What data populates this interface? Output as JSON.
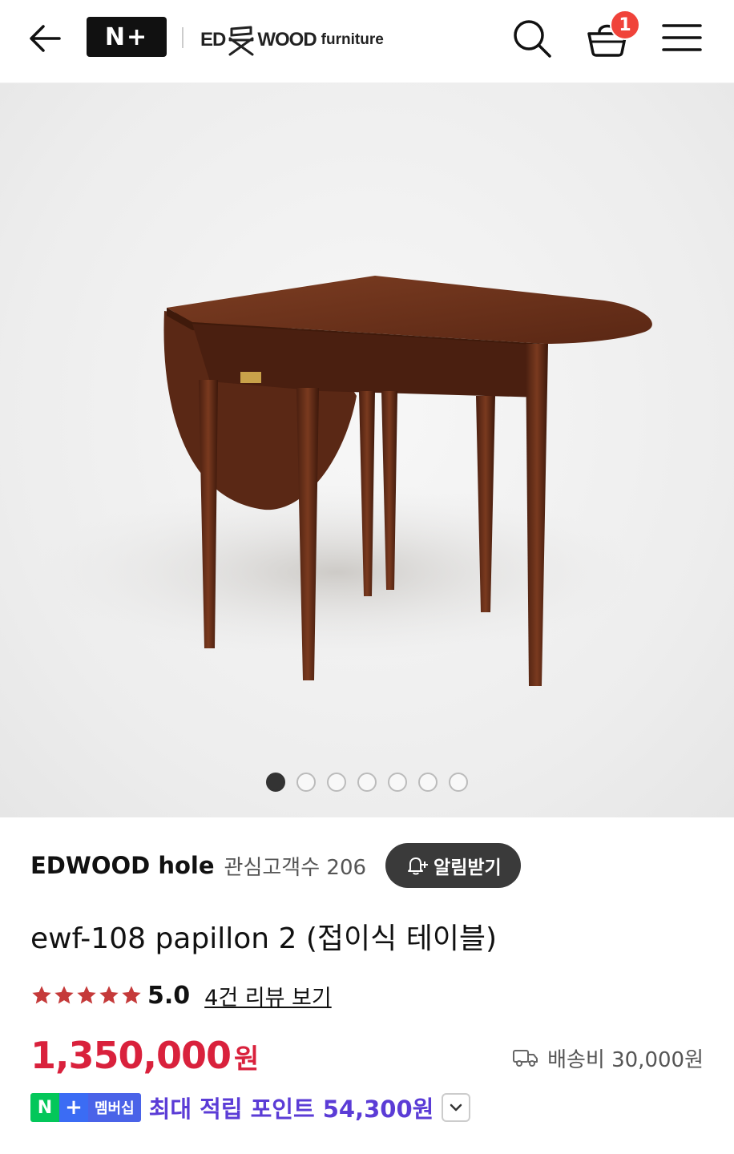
{
  "header": {
    "nplus_logo": "N+",
    "brand_left": "ED",
    "brand_right": "WOOD",
    "brand_suffix": "furniture",
    "cart_count": "1"
  },
  "gallery": {
    "total_images": 7,
    "active_index": 0
  },
  "store": {
    "name": "EDWOOD hole",
    "watchers_label": "관심고객수 206",
    "alert_button": "알림받기"
  },
  "product": {
    "title": "ewf-108 papillon 2 (접이식 테이블)",
    "rating": "5.0",
    "star_count": 5,
    "review_link": "4건 리뷰 보기",
    "price": "1,350,000",
    "currency": "원",
    "shipping": "배송비 30,000원"
  },
  "points": {
    "badge_n": "N",
    "badge_plus": "+",
    "badge_member": "멤버십",
    "text": "최대 적립 포인트 54,300원"
  },
  "colors": {
    "price": "#d9213c",
    "points": "#5b3cd6",
    "badge": "#f0433a",
    "naver_green": "#03c75a"
  }
}
